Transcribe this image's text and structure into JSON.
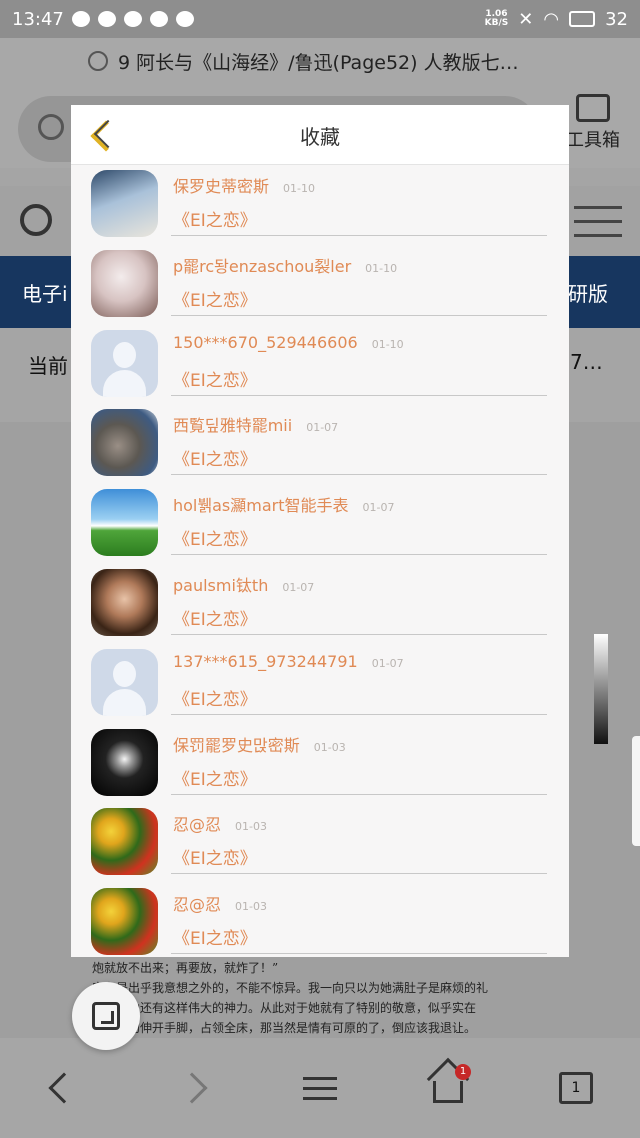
{
  "status_bar": {
    "time": "13:47",
    "net_speed_value": "1.06",
    "net_speed_unit": "KB/S",
    "battery": "32"
  },
  "browser": {
    "page_title": "9 阿长与《山海经》/鲁迅(Page52) 人教版七…",
    "toolbox_label": "工具箱",
    "band_left": "电子i",
    "band_right": "研版",
    "current_left": "当前",
    "current_right": "7…",
    "doc_text": [
      "炮就放不出来；再要放，就炸了！”",
      "实在是出乎我意想之外的，不能不惊异。我一向只以为她满肚子是麻烦的礼",
      "却不料她还有这样伟大的神力。从此对于她就有了特别的敬意，似乎实在",
      "；夜间的伸开手脚，占领全床，那当然是情有可原的了，倒应该我退让。"
    ],
    "tabs_count": "1",
    "home_badge": "1"
  },
  "modal": {
    "title": "收藏",
    "items": [
      {
        "name": "保罗史蒂密斯",
        "date": "01-10",
        "book": "《EI之恋》",
        "avatar": "a1"
      },
      {
        "name": "p罷rc돵enzaschou裂ler",
        "date": "01-10",
        "book": "《EI之恋》",
        "avatar": "a2"
      },
      {
        "name": "150***670_529446606",
        "date": "01-10",
        "book": "《EI之恋》",
        "avatar": "placeholder"
      },
      {
        "name": "西覧딮雅特罷mii",
        "date": "01-07",
        "book": "《EI之恋》",
        "avatar": "a4"
      },
      {
        "name": "hol뷁as灦mart智能手表",
        "date": "01-07",
        "book": "《EI之恋》",
        "avatar": "a5"
      },
      {
        "name": "paulsmi钛th",
        "date": "01-07",
        "book": "《EI之恋》",
        "avatar": "a6"
      },
      {
        "name": "137***615_973244791",
        "date": "01-07",
        "book": "《EI之恋》",
        "avatar": "placeholder"
      },
      {
        "name": "保罚罷罗史맍密斯",
        "date": "01-03",
        "book": "《EI之恋》",
        "avatar": "a8"
      },
      {
        "name": "忍@忍",
        "date": "01-03",
        "book": "《EI之恋》",
        "avatar": "a9"
      },
      {
        "name": "忍@忍",
        "date": "01-03",
        "book": "《EI之恋》",
        "avatar": "a9"
      }
    ]
  },
  "colors": {
    "accent_orange": "#e08a55",
    "back_arrow_yellow": "#e0b224",
    "band_blue": "#17365f"
  }
}
